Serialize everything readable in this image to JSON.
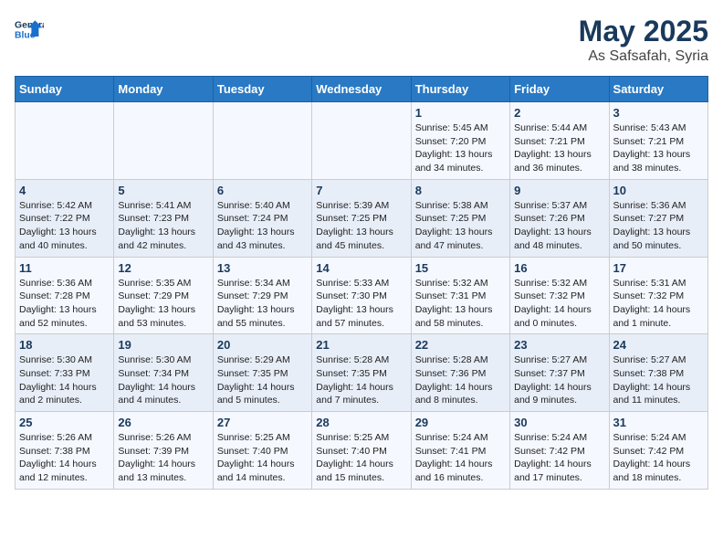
{
  "header": {
    "logo_line1": "General",
    "logo_line2": "Blue",
    "month": "May 2025",
    "location": "As Safsafah, Syria"
  },
  "days_of_week": [
    "Sunday",
    "Monday",
    "Tuesday",
    "Wednesday",
    "Thursday",
    "Friday",
    "Saturday"
  ],
  "weeks": [
    [
      {
        "day": "",
        "info": ""
      },
      {
        "day": "",
        "info": ""
      },
      {
        "day": "",
        "info": ""
      },
      {
        "day": "",
        "info": ""
      },
      {
        "day": "1",
        "info": "Sunrise: 5:45 AM\nSunset: 7:20 PM\nDaylight: 13 hours\nand 34 minutes."
      },
      {
        "day": "2",
        "info": "Sunrise: 5:44 AM\nSunset: 7:21 PM\nDaylight: 13 hours\nand 36 minutes."
      },
      {
        "day": "3",
        "info": "Sunrise: 5:43 AM\nSunset: 7:21 PM\nDaylight: 13 hours\nand 38 minutes."
      }
    ],
    [
      {
        "day": "4",
        "info": "Sunrise: 5:42 AM\nSunset: 7:22 PM\nDaylight: 13 hours\nand 40 minutes."
      },
      {
        "day": "5",
        "info": "Sunrise: 5:41 AM\nSunset: 7:23 PM\nDaylight: 13 hours\nand 42 minutes."
      },
      {
        "day": "6",
        "info": "Sunrise: 5:40 AM\nSunset: 7:24 PM\nDaylight: 13 hours\nand 43 minutes."
      },
      {
        "day": "7",
        "info": "Sunrise: 5:39 AM\nSunset: 7:25 PM\nDaylight: 13 hours\nand 45 minutes."
      },
      {
        "day": "8",
        "info": "Sunrise: 5:38 AM\nSunset: 7:25 PM\nDaylight: 13 hours\nand 47 minutes."
      },
      {
        "day": "9",
        "info": "Sunrise: 5:37 AM\nSunset: 7:26 PM\nDaylight: 13 hours\nand 48 minutes."
      },
      {
        "day": "10",
        "info": "Sunrise: 5:36 AM\nSunset: 7:27 PM\nDaylight: 13 hours\nand 50 minutes."
      }
    ],
    [
      {
        "day": "11",
        "info": "Sunrise: 5:36 AM\nSunset: 7:28 PM\nDaylight: 13 hours\nand 52 minutes."
      },
      {
        "day": "12",
        "info": "Sunrise: 5:35 AM\nSunset: 7:29 PM\nDaylight: 13 hours\nand 53 minutes."
      },
      {
        "day": "13",
        "info": "Sunrise: 5:34 AM\nSunset: 7:29 PM\nDaylight: 13 hours\nand 55 minutes."
      },
      {
        "day": "14",
        "info": "Sunrise: 5:33 AM\nSunset: 7:30 PM\nDaylight: 13 hours\nand 57 minutes."
      },
      {
        "day": "15",
        "info": "Sunrise: 5:32 AM\nSunset: 7:31 PM\nDaylight: 13 hours\nand 58 minutes."
      },
      {
        "day": "16",
        "info": "Sunrise: 5:32 AM\nSunset: 7:32 PM\nDaylight: 14 hours\nand 0 minutes."
      },
      {
        "day": "17",
        "info": "Sunrise: 5:31 AM\nSunset: 7:32 PM\nDaylight: 14 hours\nand 1 minute."
      }
    ],
    [
      {
        "day": "18",
        "info": "Sunrise: 5:30 AM\nSunset: 7:33 PM\nDaylight: 14 hours\nand 2 minutes."
      },
      {
        "day": "19",
        "info": "Sunrise: 5:30 AM\nSunset: 7:34 PM\nDaylight: 14 hours\nand 4 minutes."
      },
      {
        "day": "20",
        "info": "Sunrise: 5:29 AM\nSunset: 7:35 PM\nDaylight: 14 hours\nand 5 minutes."
      },
      {
        "day": "21",
        "info": "Sunrise: 5:28 AM\nSunset: 7:35 PM\nDaylight: 14 hours\nand 7 minutes."
      },
      {
        "day": "22",
        "info": "Sunrise: 5:28 AM\nSunset: 7:36 PM\nDaylight: 14 hours\nand 8 minutes."
      },
      {
        "day": "23",
        "info": "Sunrise: 5:27 AM\nSunset: 7:37 PM\nDaylight: 14 hours\nand 9 minutes."
      },
      {
        "day": "24",
        "info": "Sunrise: 5:27 AM\nSunset: 7:38 PM\nDaylight: 14 hours\nand 11 minutes."
      }
    ],
    [
      {
        "day": "25",
        "info": "Sunrise: 5:26 AM\nSunset: 7:38 PM\nDaylight: 14 hours\nand 12 minutes."
      },
      {
        "day": "26",
        "info": "Sunrise: 5:26 AM\nSunset: 7:39 PM\nDaylight: 14 hours\nand 13 minutes."
      },
      {
        "day": "27",
        "info": "Sunrise: 5:25 AM\nSunset: 7:40 PM\nDaylight: 14 hours\nand 14 minutes."
      },
      {
        "day": "28",
        "info": "Sunrise: 5:25 AM\nSunset: 7:40 PM\nDaylight: 14 hours\nand 15 minutes."
      },
      {
        "day": "29",
        "info": "Sunrise: 5:24 AM\nSunset: 7:41 PM\nDaylight: 14 hours\nand 16 minutes."
      },
      {
        "day": "30",
        "info": "Sunrise: 5:24 AM\nSunset: 7:42 PM\nDaylight: 14 hours\nand 17 minutes."
      },
      {
        "day": "31",
        "info": "Sunrise: 5:24 AM\nSunset: 7:42 PM\nDaylight: 14 hours\nand 18 minutes."
      }
    ]
  ]
}
